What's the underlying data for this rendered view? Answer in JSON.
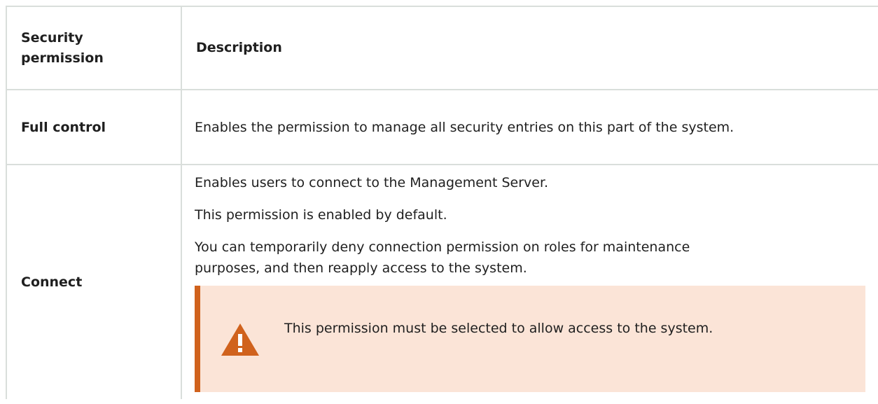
{
  "table": {
    "headers": {
      "permission": "Security permission",
      "description": "Description"
    },
    "rows": [
      {
        "permission": "Full control",
        "description": "Enables the permission to manage all security entries on this part of the system."
      },
      {
        "permission": "Connect",
        "paragraphs": [
          "Enables users to connect to the Management Server.",
          "This permission is enabled by default.",
          "You can temporarily deny connection permission on roles for maintenance purposes, and then reapply access to the system."
        ],
        "warning": {
          "icon": "warning-icon",
          "text": "This permission must be selected to allow access to the system."
        }
      }
    ]
  },
  "colors": {
    "border": "#d9dedb",
    "warning_bg": "#fbe4d7",
    "warning_accent": "#d0621d"
  }
}
